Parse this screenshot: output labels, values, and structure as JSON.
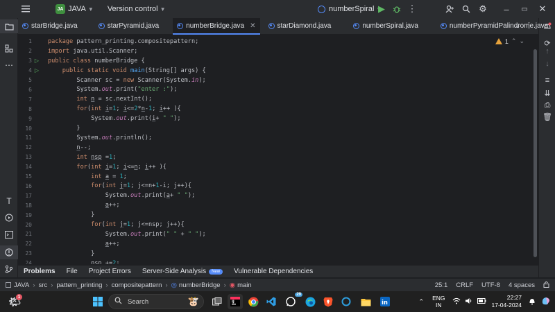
{
  "titlebar": {
    "project_badge": "JA",
    "project_name": "JAVA",
    "vcs_label": "Version control",
    "run_config": "numberSpiral"
  },
  "tabs": [
    {
      "label": "starBridge.java",
      "active": false
    },
    {
      "label": "starPyramid.java",
      "active": false
    },
    {
      "label": "numberBridge.java",
      "active": true
    },
    {
      "label": "starDiamond.java",
      "active": false
    },
    {
      "label": "numberSpiral.java",
      "active": false
    },
    {
      "label": "numberPyramidPalindrome.java",
      "active": false
    }
  ],
  "editor": {
    "inspection_count": "1",
    "lines": [
      {
        "n": "1",
        "html": "<span class=\"kw\">package</span> pattern_printing.compositepattern;"
      },
      {
        "n": "2",
        "html": "<span class=\"kw\">import</span> java.util.Scanner;"
      },
      {
        "n": "3",
        "html": "<span class=\"kw\">public class</span> numberBridge {",
        "run": true
      },
      {
        "n": "4",
        "html": "    <span class=\"kw\">public static void</span> <span class=\"fn\">main</span>(String[] args) {",
        "run": true
      },
      {
        "n": "5",
        "html": "        Scanner sc = <span class=\"kw\">new</span> Scanner(System.<span class=\"it\">in</span>);"
      },
      {
        "n": "6",
        "html": "        System.<span class=\"it\">out</span>.print(<span class=\"st\">\"enter :\"</span>);"
      },
      {
        "n": "7",
        "html": "        <span class=\"kw\">int</span> <span class=\"ul\">n</span> = sc.nextInt();"
      },
      {
        "n": "8",
        "html": "        <span class=\"kw\">for</span>(<span class=\"kw\">int</span> <span class=\"ul\">i</span>=<span class=\"nm\">1</span>; <span class=\"ul\">i</span>&lt;=<span class=\"nm\">2</span>*<span class=\"ul\">n</span>-<span class=\"nm\">1</span>; <span class=\"ul\">i</span>++ ){"
      },
      {
        "n": "9",
        "html": "            System.<span class=\"it\">out</span>.print(<span class=\"ul\">i</span>+ <span class=\"st\">\" \"</span>);"
      },
      {
        "n": "10",
        "html": "        }"
      },
      {
        "n": "11",
        "html": "        System.<span class=\"it\">out</span>.println();"
      },
      {
        "n": "12",
        "html": "        <span class=\"ul\">n</span>--;"
      },
      {
        "n": "13",
        "html": "        <span class=\"kw\">int</span> <span class=\"ul\">nsp</span> =<span class=\"nm\">1</span>;"
      },
      {
        "n": "14",
        "html": "        <span class=\"kw\">for</span>(<span class=\"kw\">int</span> <span class=\"ul\">i</span>=<span class=\"nm\">1</span>; <span class=\"ul\">i</span>&lt;=<span class=\"ul\">n</span>; <span class=\"ul\">i</span>++ ){"
      },
      {
        "n": "15",
        "html": "            <span class=\"kw\">int</span> <span class=\"ul\">a</span> = <span class=\"nm\">1</span>;"
      },
      {
        "n": "16",
        "html": "            <span class=\"kw\">for</span>(<span class=\"kw\">int</span> <span class=\"ul\">j</span>=<span class=\"nm\">1</span>; j&lt;=n+<span class=\"nm\">1</span>-i; j++){"
      },
      {
        "n": "17",
        "html": "                System.<span class=\"it\">out</span>.print(<span class=\"ul\">a</span>+ <span class=\"st\">\" \"</span>);"
      },
      {
        "n": "18",
        "html": "                <span class=\"ul\">a</span>++;"
      },
      {
        "n": "19",
        "html": "            }"
      },
      {
        "n": "20",
        "html": "            <span class=\"kw\">for</span>(<span class=\"kw\">int</span> <span class=\"ul\">j</span>=<span class=\"nm\">1</span>; j&lt;=nsp; j++){"
      },
      {
        "n": "21",
        "html": "                System.<span class=\"it\">out</span>.print(<span class=\"st\">\" \"</span> + <span class=\"st\">\" \"</span>);"
      },
      {
        "n": "22",
        "html": "                <span class=\"ul\">a</span>++;"
      },
      {
        "n": "23",
        "html": "            }"
      },
      {
        "n": "24",
        "html": "            nsp +=<span class=\"nm\">2</span>;"
      }
    ]
  },
  "bottom_panel": {
    "tabs": [
      "Problems",
      "File",
      "Project Errors",
      "Server-Side Analysis",
      "Vulnerable Dependencies"
    ],
    "new_badge": "New"
  },
  "statusbar": {
    "breadcrumb": [
      "JAVA",
      "src",
      "pattern_printing",
      "compositepattern",
      "numberBridge",
      "main"
    ],
    "position": "25:1",
    "line_sep": "CRLF",
    "encoding": "UTF-8",
    "indent": "4 spaces"
  },
  "taskbar": {
    "search_placeholder": "Search",
    "whatsapp_badge": "29",
    "weather_badge": "1",
    "lang_top": "ENG",
    "lang_bottom": "IN",
    "time": "22:27",
    "date": "17-04-2024"
  },
  "colors": {
    "accent": "#548af7",
    "keyword": "#cf8e6d",
    "string": "#6aab73",
    "number": "#2aacb8",
    "function": "#56a8f5"
  }
}
